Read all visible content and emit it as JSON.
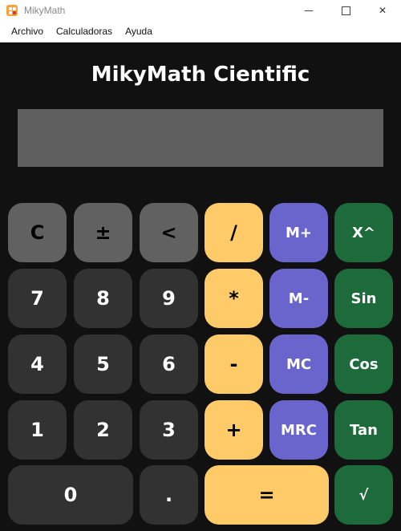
{
  "window": {
    "title": "MikyMath",
    "minimize_glyph": "—",
    "close_glyph": "✕"
  },
  "menu": [
    "Archivo",
    "Calculadoras",
    "Ayuda"
  ],
  "app": {
    "heading": "MikyMath Cientific"
  },
  "display": {
    "value": ""
  },
  "keys": {
    "clear": "C",
    "sign": "±",
    "backspace": "<",
    "divide": "/",
    "mplus": "M+",
    "power": "X^",
    "seven": "7",
    "eight": "8",
    "nine": "9",
    "multiply": "*",
    "mminus": "M-",
    "sin": "Sin",
    "four": "4",
    "five": "5",
    "six": "6",
    "minus": "-",
    "mc": "MC",
    "cos": "Cos",
    "one": "1",
    "two": "2",
    "three": "3",
    "plus": "+",
    "mrc": "MRC",
    "tan": "Tan",
    "zero": "0",
    "dot": ".",
    "equals": "=",
    "sqrt": "√"
  },
  "colors": {
    "gray": "#616161",
    "dark": "#323232",
    "yellow": "#ffcb69",
    "purple": "#6a64cd",
    "green": "#1d6b3a",
    "display": "#5f5f5f",
    "background": "#111111"
  }
}
